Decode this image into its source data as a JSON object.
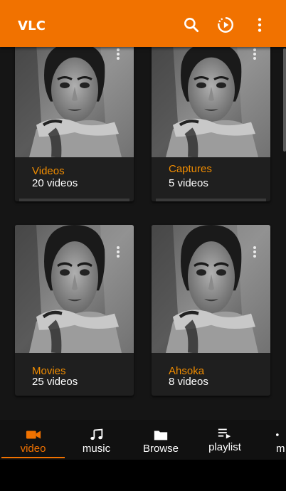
{
  "app": {
    "title": "VLC"
  },
  "toolbar": {
    "icons": [
      "search-icon",
      "resume-playback-icon",
      "more-vert-icon"
    ]
  },
  "folders": [
    {
      "name": "Videos",
      "count": "20 videos"
    },
    {
      "name": "Captures",
      "count": "5 videos"
    },
    {
      "name": "Movies",
      "count": "25 videos"
    },
    {
      "name": "Ahsoka",
      "count": "8 videos"
    }
  ],
  "nav": {
    "items": [
      {
        "label": "video",
        "icon": "videocam-icon",
        "active": true
      },
      {
        "label": "music",
        "icon": "music-note-icon"
      },
      {
        "label": "Browse",
        "icon": "folder-icon"
      },
      {
        "label": "playlist",
        "icon": "playlist-play-icon"
      },
      {
        "label": "m",
        "icon": "more-icon"
      }
    ]
  },
  "colors": {
    "accent": "#f17200",
    "folder_name": "#f08c00",
    "background": "#151515",
    "card": "#1f1f1f"
  }
}
